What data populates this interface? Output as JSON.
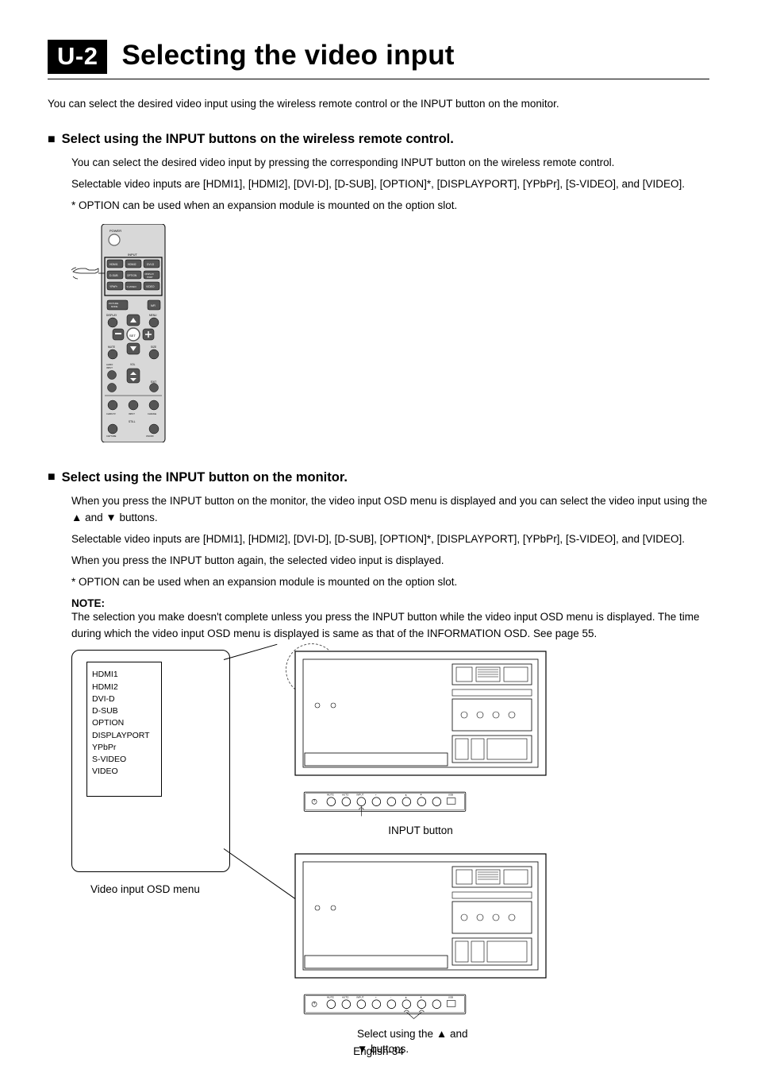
{
  "chapter": {
    "badge": "U-2",
    "title": "Selecting the video input"
  },
  "intro": "You can select the desired video input using the wireless remote control or the INPUT button on the monitor.",
  "section1": {
    "heading": "Select using the INPUT buttons on the wireless remote control.",
    "lines": [
      "You can select the desired video input by pressing the corresponding INPUT button on the wireless remote control.",
      "Selectable video inputs are [HDMI1], [HDMI2], [DVI-D], [D-SUB], [OPTION]*, [DISPLAYPORT], [YPbPr], [S-VIDEO], and [VIDEO].",
      "* OPTION can be used when an expansion module is mounted on the option slot."
    ]
  },
  "remote": {
    "labels": {
      "power": "POWER",
      "input": "INPUT",
      "row1": [
        "HDMI1",
        "HDMI2",
        "DVI-D"
      ],
      "row2": [
        "D-SUB",
        "OPTION",
        "DISPLAY PORT"
      ],
      "row3": [
        "YPbPr",
        "S-VIDEO",
        "VIDEO"
      ],
      "picture_mode": "PICTURE MODE",
      "nr": "N/R",
      "display": "DISPLAY",
      "menu": "MENU",
      "set": "SET",
      "mute": "MUTE",
      "size": "SIZE",
      "audio_input": "AUDIO INPUT",
      "exit": "EXIT",
      "vol": "VOL",
      "ch_btns": [
        "CH/RGTV",
        "INPUT",
        "CHANGE"
      ],
      "still": "STILL",
      "capture": "CAPTURE"
    }
  },
  "section2": {
    "heading": "Select using the INPUT button on the monitor.",
    "lines_part1": "When you press the INPUT button on the monitor, the video input OSD menu is displayed and you can select the video input using the ",
    "lines_part1b": " and ",
    "lines_part1c": " buttons.",
    "lines_2": "Selectable video inputs are [HDMI1], [HDMI2], [DVI-D], [D-SUB], [OPTION]*, [DISPLAYPORT], [YPbPr], [S-VIDEO], and [VIDEO].",
    "lines_3": "When you press the INPUT button again, the selected video input is displayed.",
    "lines_4": "* OPTION can be used when an expansion module is mounted on the option slot.",
    "note_label": "NOTE:",
    "note_text": "The selection you make doesn't complete unless you press the INPUT button while the video input OSD menu is displayed. The time during which the video input OSD menu is displayed is same as that of the INFORMATION OSD. See page 55."
  },
  "osd": {
    "items": [
      "HDMI1",
      "HDMI2",
      "DVI-D",
      "D-SUB",
      "OPTION",
      "DISPLAYPORT",
      "YPbPr",
      "S-VIDEO",
      "VIDEO"
    ],
    "caption": "Video input OSD menu"
  },
  "panel": {
    "caption_input": "INPUT button",
    "caption_sel_1": "Select using the ",
    "caption_sel_2": " and ",
    "caption_sel_3": " buttons.",
    "labels": [
      "",
      "AUTO",
      "INPUT",
      "+",
      "-",
      "▲",
      "▼",
      "",
      "USB"
    ]
  },
  "footer": "English-34"
}
